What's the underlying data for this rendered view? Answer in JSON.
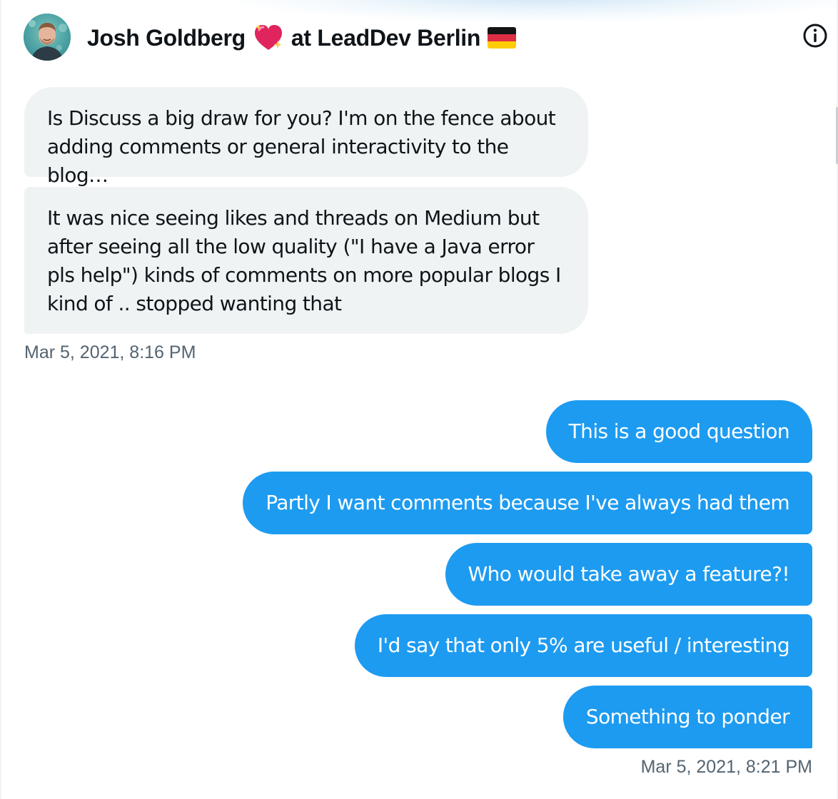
{
  "header": {
    "name": "Josh Goldberg",
    "suffix": "at LeadDev Berlin",
    "heart_icon": "sparkling-heart-icon",
    "flag_icon": "germany-flag-icon",
    "info_icon": "info-icon"
  },
  "colors": {
    "incoming_bubble": "#eff3f4",
    "outgoing_bubble": "#1d9bf0",
    "text_primary": "#0f1419",
    "text_secondary": "#536471"
  },
  "messages": {
    "incoming": [
      {
        "text": "Is Discuss a big draw for you? I'm on the fence about adding comments or general interactivity to the blog…"
      },
      {
        "text": "It was nice seeing likes and threads on Medium but after seeing all the low quality (\"I have a Java error pls help\") kinds of comments on more popular blogs I kind of .. stopped wanting that"
      }
    ],
    "incoming_timestamp": "Mar 5, 2021, 8:16 PM",
    "outgoing": [
      {
        "text": "This is a good question"
      },
      {
        "text": "Partly I want comments because I've always had them"
      },
      {
        "text": "Who would take away a feature?!"
      },
      {
        "text": "I'd say that only 5% are useful / interesting"
      },
      {
        "text": "Something to ponder"
      }
    ],
    "outgoing_timestamp": "Mar 5, 2021, 8:21 PM"
  }
}
